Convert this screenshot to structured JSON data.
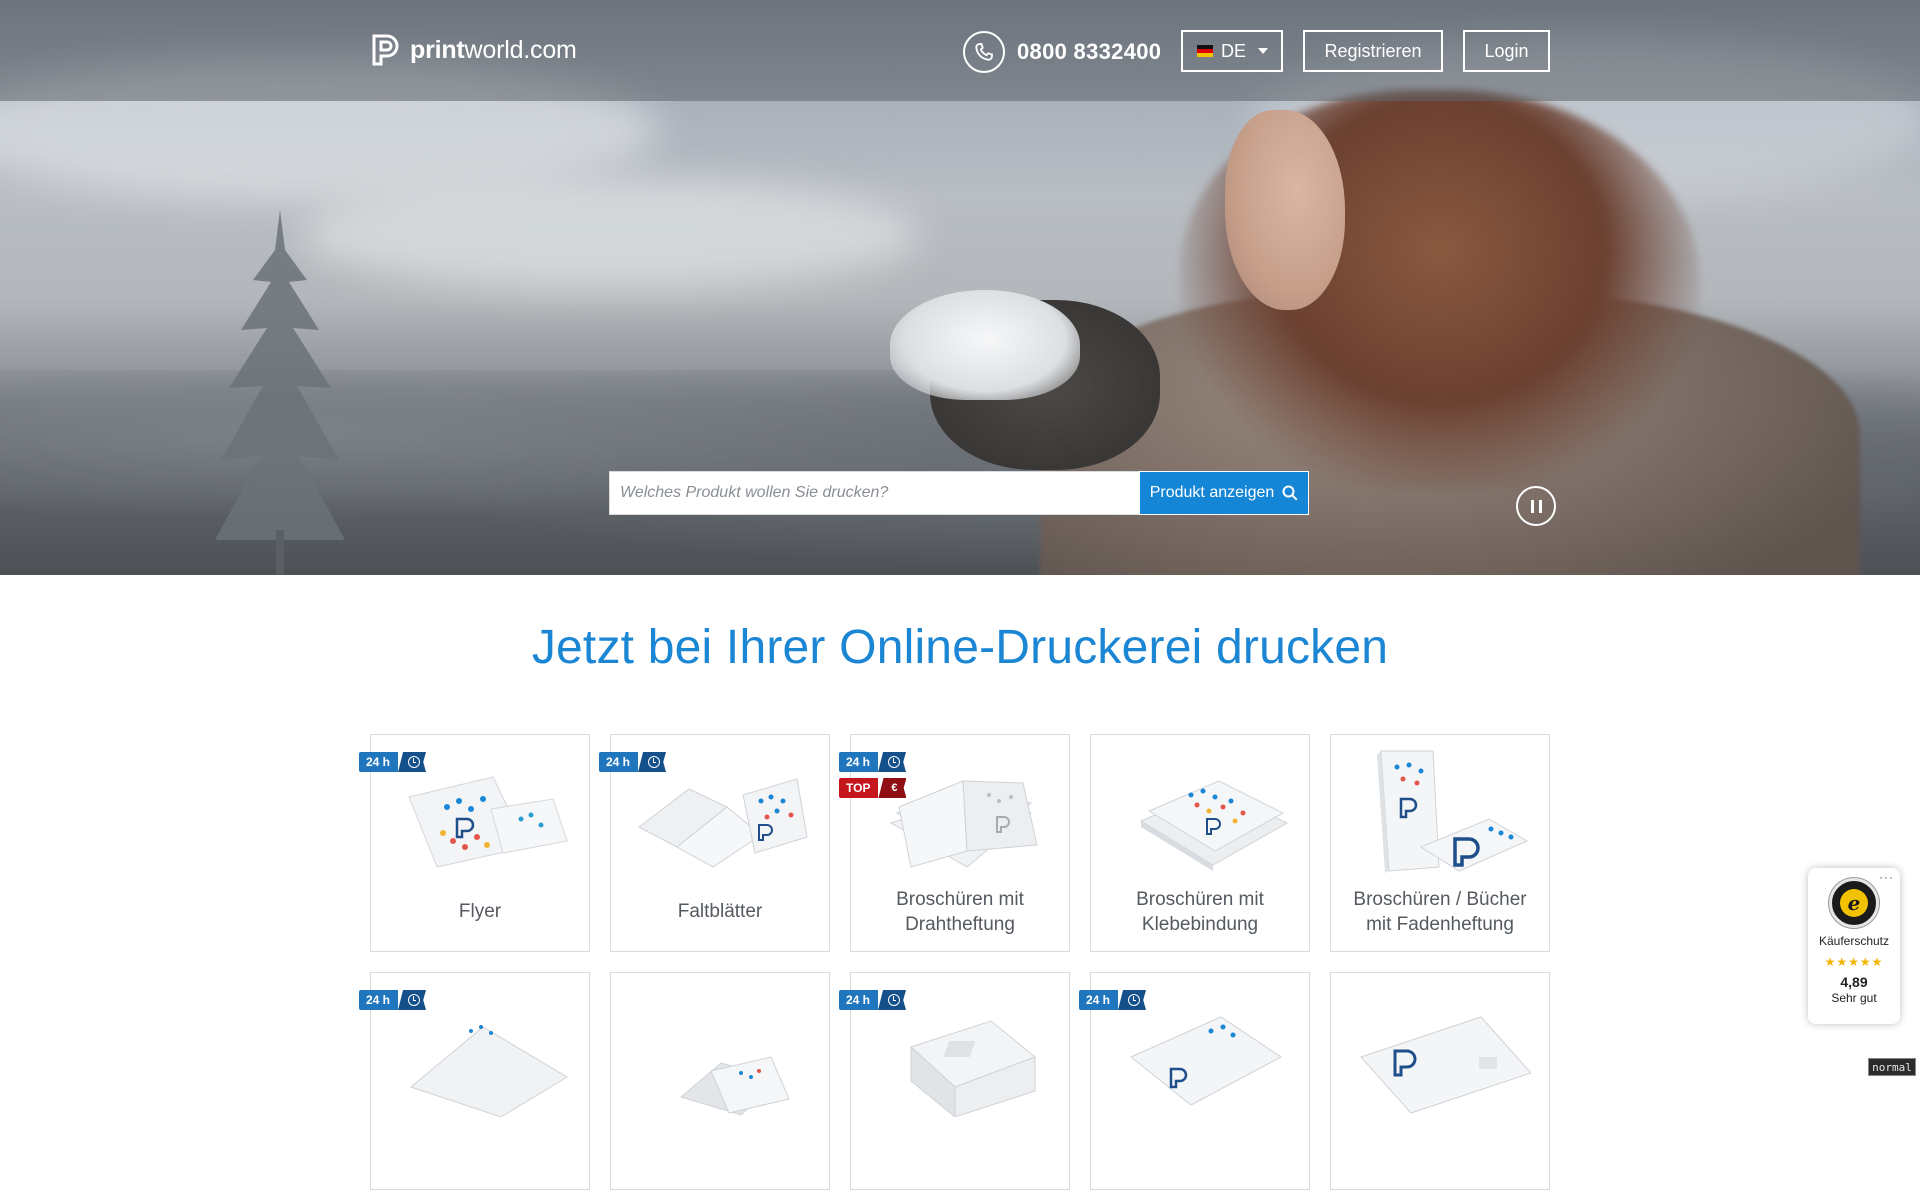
{
  "header": {
    "logo_text_a": "print",
    "logo_text_b": "world.com",
    "phone_number": "0800 8332400",
    "language": "DE",
    "register_label": "Registrieren",
    "login_label": "Login"
  },
  "search": {
    "placeholder": "Welches Produkt wollen Sie drucken?",
    "button_label": "Produkt anzeigen"
  },
  "main": {
    "headline": "Jetzt bei Ihrer Online-Druckerei drucken",
    "products_row1": [
      {
        "label_lines": [
          "Flyer"
        ],
        "badges": [
          "24 h"
        ]
      },
      {
        "label_lines": [
          "Faltblätter"
        ],
        "badges": [
          "24 h"
        ]
      },
      {
        "label_lines": [
          "Broschüren mit",
          "Drahtheftung"
        ],
        "badges": [
          "24 h",
          "TOP"
        ]
      },
      {
        "label_lines": [
          "Broschüren mit",
          "Klebebindung"
        ],
        "badges": []
      },
      {
        "label_lines": [
          "Broschüren / Bücher",
          "mit Fadenheftung"
        ],
        "badges": []
      }
    ],
    "badge_24h": "24 h",
    "badge_top": "TOP",
    "badge_euro": "€"
  },
  "trust_badge": {
    "title": "Käuferschutz",
    "stars": "★★★★★",
    "score": "4,89",
    "rating": "Sehr gut",
    "more": "···",
    "seal_letter": "e"
  },
  "status": {
    "mode": "normal"
  },
  "colors": {
    "accent": "#1a86d4",
    "badge_blue": "#1f76bd",
    "badge_red": "#c4161c"
  }
}
